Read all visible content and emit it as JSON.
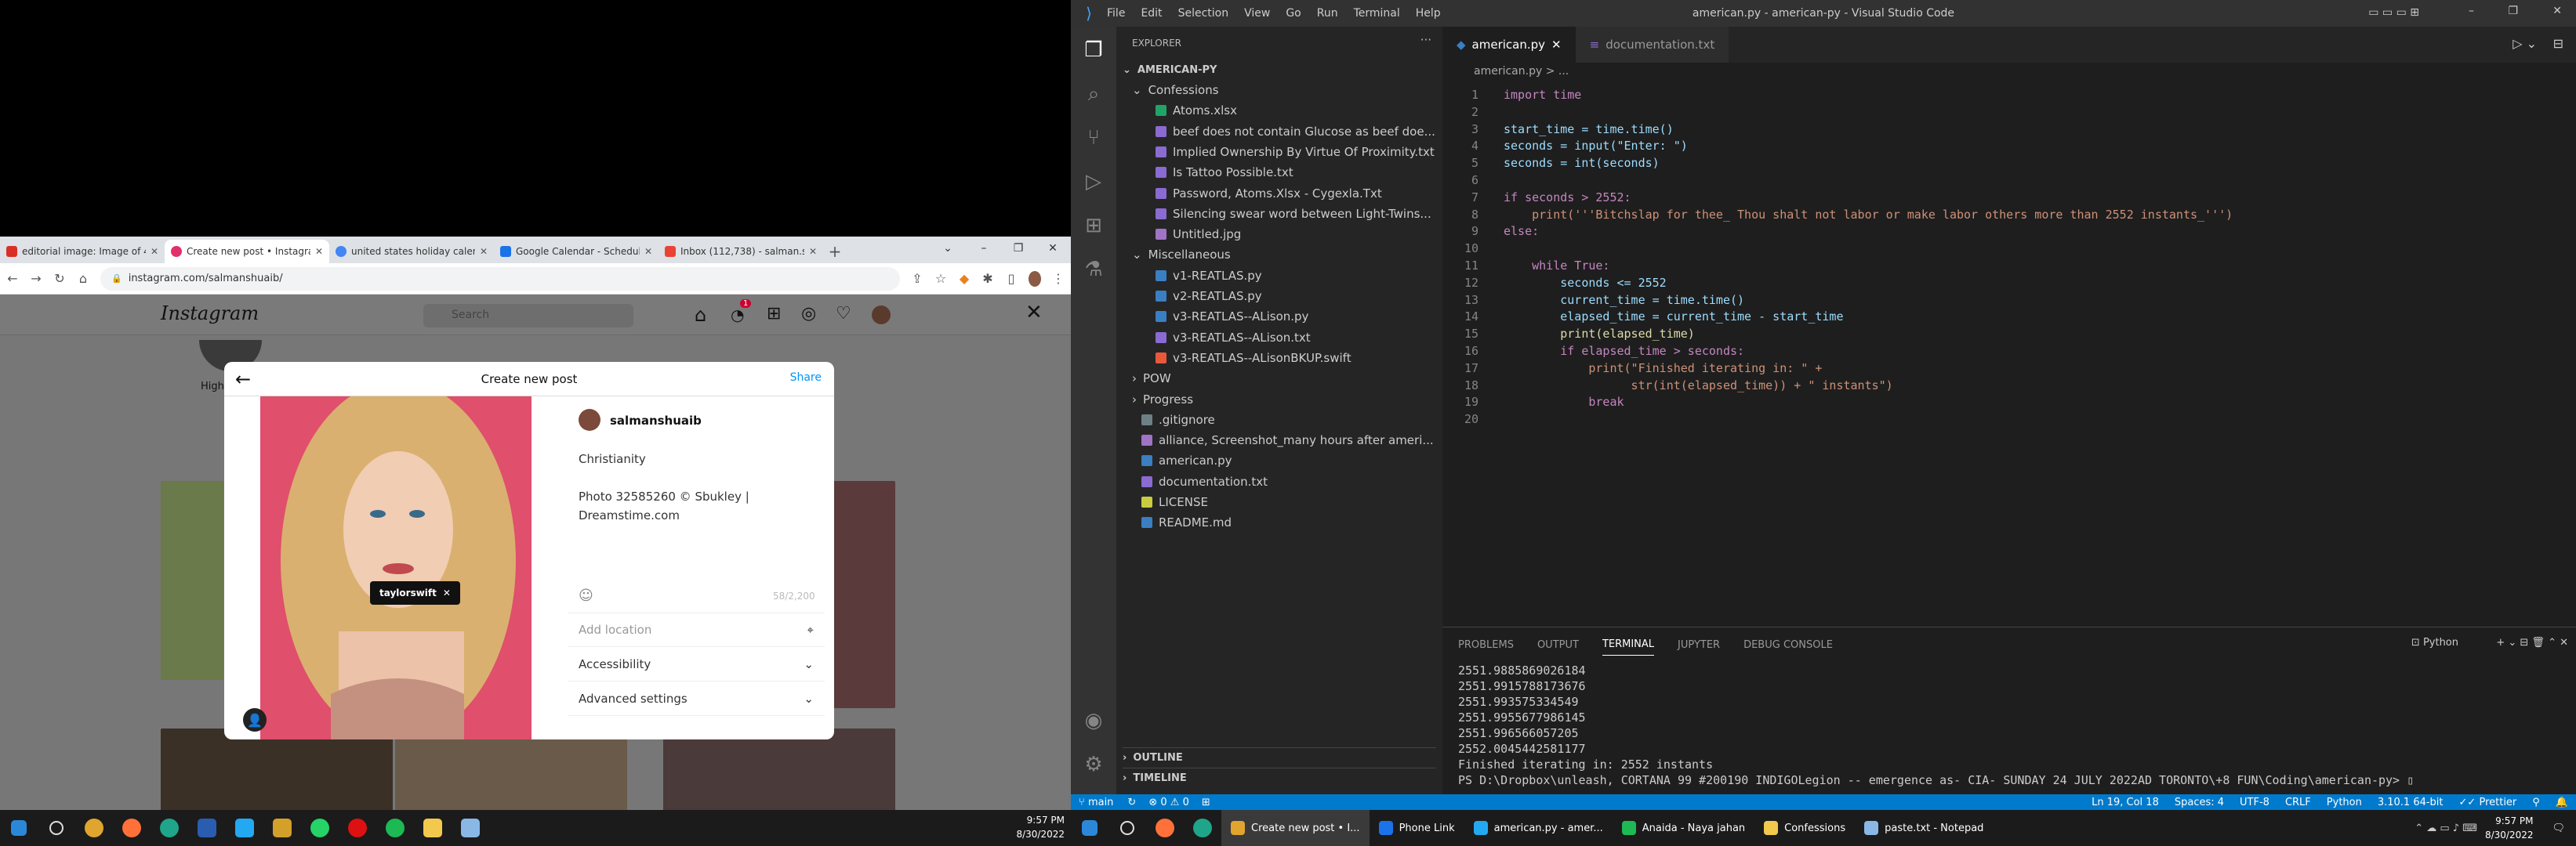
{
  "chrome": {
    "tabs": [
      {
        "title": "editorial image: Image of 4'...",
        "color": "#d93025"
      },
      {
        "title": "Create new post • Instagram",
        "color": "#e1306c",
        "active": true
      },
      {
        "title": "united states holiday calend...",
        "color": "#4285f4"
      },
      {
        "title": "Google Calendar - Schedule...",
        "color": "#1a73e8"
      },
      {
        "title": "Inbox (112,738) - salman.sh...",
        "color": "#ea4335"
      }
    ],
    "url": "instagram.com/salmanshuaib/"
  },
  "instagram": {
    "logo": "Instagram",
    "search_placeholder": "Search",
    "highlight_label": "High",
    "notif_count": "1",
    "dialog": {
      "title": "Create new post",
      "share": "Share",
      "username": "salmanshuaib",
      "caption_line1": "Christianity",
      "caption_line2": "Photo 32585260 © Sbukley |",
      "caption_line3": "Dreamstime.com",
      "char_count": "58/2,200",
      "tag": "taylorswift",
      "add_location": "Add location",
      "accessibility": "Accessibility",
      "advanced": "Advanced settings"
    }
  },
  "taskbar_left": {
    "time": "9:57 PM",
    "date": "8/30/2022"
  },
  "vscode": {
    "menu": [
      "File",
      "Edit",
      "Selection",
      "View",
      "Go",
      "Run",
      "Terminal",
      "Help"
    ],
    "window_title": "american.py - american-py - Visual Studio Code",
    "explorer_title": "EXPLORER",
    "root": "AMERICAN-PY",
    "tree": [
      {
        "label": "Confessions",
        "indent": 1,
        "folder": true,
        "open": true
      },
      {
        "label": "Atoms.xlsx",
        "indent": 2,
        "color": "#21a366"
      },
      {
        "label": "beef does not contain Glucose as beef doe...",
        "indent": 2,
        "color": "#8a6bd1"
      },
      {
        "label": "Implied Ownership By Virtue Of Proximity.txt",
        "indent": 2,
        "color": "#8a6bd1"
      },
      {
        "label": "Is Tattoo Possible.txt",
        "indent": 2,
        "color": "#8a6bd1"
      },
      {
        "label": "Password, Atoms.Xlsx - Cygexla.Txt",
        "indent": 2,
        "color": "#8a6bd1"
      },
      {
        "label": "Silencing swear word between Light-Twins...",
        "indent": 2,
        "color": "#8a6bd1"
      },
      {
        "label": "Untitled.jpg",
        "indent": 2,
        "color": "#a074c4"
      },
      {
        "label": "Miscellaneous",
        "indent": 1,
        "folder": true,
        "open": true
      },
      {
        "label": "v1-REATLAS.py",
        "indent": 2,
        "color": "#3a7fc1"
      },
      {
        "label": "v2-REATLAS.py",
        "indent": 2,
        "color": "#3a7fc1"
      },
      {
        "label": "v3-REATLAS--ALison.py",
        "indent": 2,
        "color": "#3a7fc1"
      },
      {
        "label": "v3-REATLAS--ALison.txt",
        "indent": 2,
        "color": "#8a6bd1"
      },
      {
        "label": "v3-REATLAS--ALisonBKUP.swift",
        "indent": 2,
        "color": "#e8593a"
      },
      {
        "label": "POW",
        "indent": 1,
        "folder": true
      },
      {
        "label": "Progress",
        "indent": 1,
        "folder": true
      },
      {
        "label": ".gitignore",
        "indent": 1,
        "color": "#6d8086"
      },
      {
        "label": "alliance, Screenshot_many hours after ameri...",
        "indent": 1,
        "color": "#a074c4"
      },
      {
        "label": "american.py",
        "indent": 1,
        "color": "#3a7fc1"
      },
      {
        "label": "documentation.txt",
        "indent": 1,
        "color": "#8a6bd1"
      },
      {
        "label": "LICENSE",
        "indent": 1,
        "color": "#cbcb41"
      },
      {
        "label": "README.md",
        "indent": 1,
        "color": "#3a7fc1"
      }
    ],
    "outline": "OUTLINE",
    "timeline": "TIMELINE",
    "tabs": [
      {
        "label": "american.py",
        "active": true
      },
      {
        "label": "documentation.txt"
      }
    ],
    "breadcrumb": "american.py > ...",
    "code": [
      "import time",
      "",
      "start_time = time.time()",
      "seconds = input(\"Enter: \")",
      "seconds = int(seconds)",
      "",
      "if seconds > 2552:",
      "    print('''Bitchslap for thee_ Thou shalt not labor or make labor others more than 2552 instants_''')",
      "else:",
      "",
      "    while True:",
      "        seconds <= 2552",
      "        current_time = time.time()",
      "        elapsed_time = current_time - start_time",
      "        print(elapsed_time)",
      "        if elapsed_time > seconds:",
      "            print(\"Finished iterating in: \" +",
      "                  str(int(elapsed_time)) + \" instants\")",
      "            break",
      ""
    ],
    "panel_tabs": [
      "PROBLEMS",
      "OUTPUT",
      "TERMINAL",
      "JUPYTER",
      "DEBUG CONSOLE"
    ],
    "panel_active": "TERMINAL",
    "panel_lang": "Python",
    "terminal": [
      "2551.9885869026184",
      "2551.9915788173676",
      "2551.993575334549",
      "2551.9955677986145",
      "2551.996566057205",
      "2552.0045442581177",
      "Finished iterating in: 2552 instants",
      "PS D:\\Dropbox\\unleash, CORTANA 99 #200190 INDIGOLegion -- emergence as- CIA- SUNDAY 24 JULY 2022AD TORONTO\\+8 FUN\\Coding\\american-py> ▯"
    ],
    "status": {
      "branch": "main",
      "errors": "0",
      "warnings": "0",
      "pos": "Ln 19, Col 18",
      "spaces": "Spaces: 4",
      "enc": "UTF-8",
      "eol": "CRLF",
      "lang": "Python",
      "interp": "3.10.1 64-bit",
      "prettier": "Prettier"
    }
  },
  "taskbar_right": {
    "tasks": [
      "Create new post • I...",
      "Phone Link",
      "american.py - amer...",
      "Anaida - Naya jahan",
      "Confessions",
      "paste.txt - Notepad"
    ],
    "time": "9:57 PM",
    "date": "8/30/2022"
  }
}
